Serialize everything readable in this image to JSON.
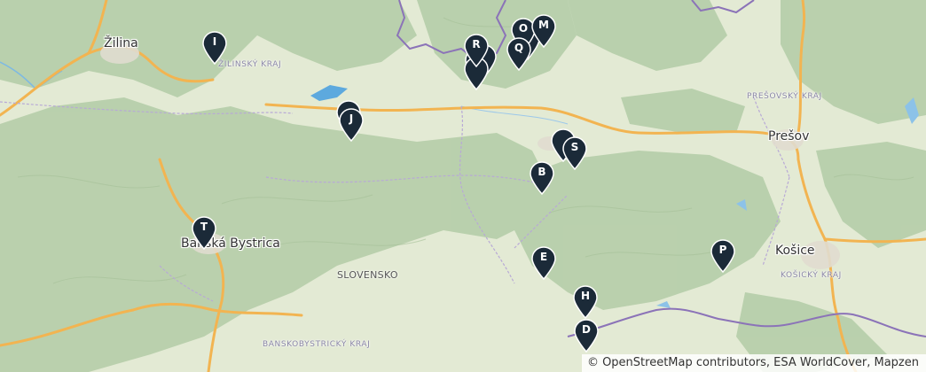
{
  "map": {
    "country_label": "SLOVENSKO",
    "cities": [
      {
        "id": "zilina",
        "name": "Žilina"
      },
      {
        "id": "presov",
        "name": "Prešov"
      },
      {
        "id": "banska-bystrica",
        "name": "Banská Bystrica"
      },
      {
        "id": "kosice",
        "name": "Košice"
      }
    ],
    "regions": [
      {
        "id": "zilinsky",
        "name": "ŽILINSKÝ KRAJ"
      },
      {
        "id": "presovsky",
        "name": "PREŠOVSKÝ KRAJ"
      },
      {
        "id": "kosicky",
        "name": "KOŠICKÝ KRAJ"
      },
      {
        "id": "banskobystricky",
        "name": "BANSKOBYSTRICKÝ KRAJ"
      }
    ],
    "markers": [
      "I",
      "R",
      "O",
      "M",
      "Q",
      "J",
      "B",
      "S",
      "T",
      "E",
      "P",
      "H",
      "D"
    ],
    "attribution": "© OpenStreetMap contributors, ESA WorldCover, Mapzen",
    "colors": {
      "forest": "#b9d0ad",
      "lowland": "#e6ebd5",
      "road": "#f2b451",
      "border": "#8b73b8",
      "water": "#69aee0",
      "marker": "#1b2a38"
    }
  }
}
